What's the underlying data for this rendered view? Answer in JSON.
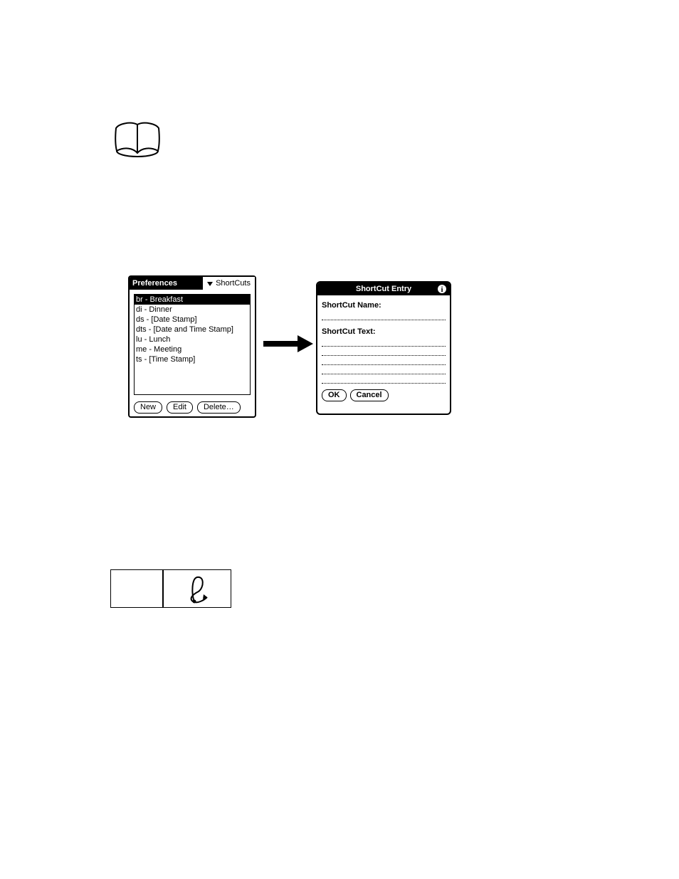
{
  "prefs": {
    "title": "Preferences",
    "dropdown_label": "ShortCuts",
    "list": [
      "br - Breakfast",
      "di - Dinner",
      "ds - [Date Stamp]",
      "dts - [Date and Time Stamp]",
      "lu - Lunch",
      "me - Meeting",
      "ts - [Time Stamp]"
    ],
    "buttons": {
      "new": "New",
      "edit": "Edit",
      "delete": "Delete…"
    }
  },
  "entry": {
    "title": "ShortCut Entry",
    "name_label": "ShortCut Name:",
    "text_label": "ShortCut Text:",
    "ok": "OK",
    "cancel": "Cancel"
  }
}
